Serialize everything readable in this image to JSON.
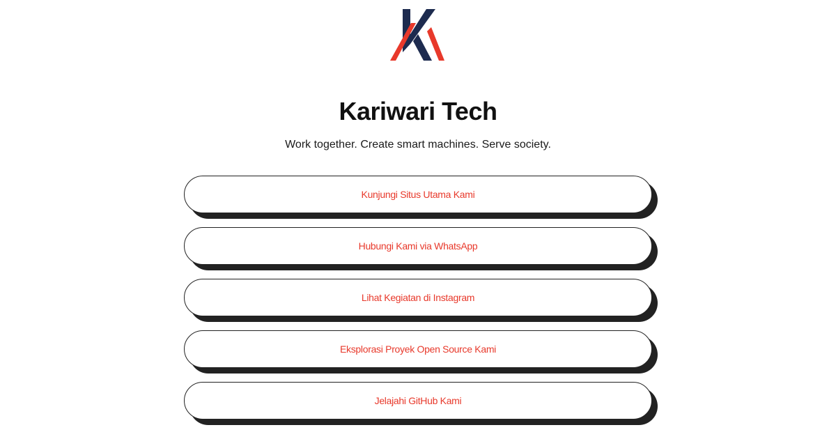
{
  "brand": {
    "logo_icon": "kariwari-logo-icon",
    "colors": {
      "navy": "#1d2b4f",
      "red": "#e8392b"
    }
  },
  "header": {
    "title": "Kariwari Tech",
    "tagline": "Work together. Create smart machines. Serve society."
  },
  "links": [
    {
      "label": "Kunjungi Situs Utama Kami"
    },
    {
      "label": "Hubungi Kami via WhatsApp"
    },
    {
      "label": "Lihat Kegiatan di Instagram"
    },
    {
      "label": "Eksplorasi Proyek Open Source Kami"
    },
    {
      "label": "Jelajahi GitHub Kami"
    }
  ],
  "style": {
    "link_text_color": "#e8392b",
    "shadow_color": "#222222",
    "background": "#ffffff"
  }
}
